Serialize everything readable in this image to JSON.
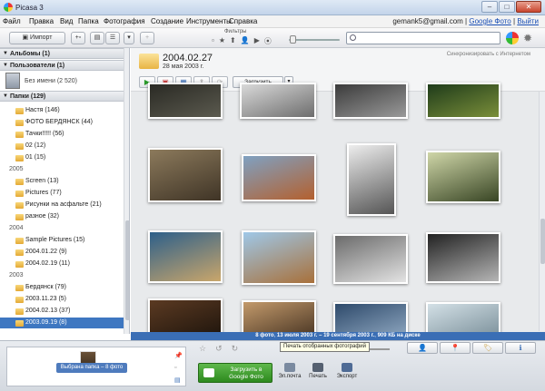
{
  "window": {
    "title": "Picasa 3"
  },
  "menu": {
    "items": [
      "Файл",
      "Правка",
      "Вид",
      "Папка",
      "Фотография",
      "Создание",
      "Инструменты",
      "Справка"
    ],
    "account_email": "gemank5@gmail.com",
    "account_sep": "|",
    "google_photo_link": "Google Фото",
    "exit_link": "Выйти"
  },
  "toolbar": {
    "import_label": "Импорт",
    "filters_label": "Фильтры",
    "search_placeholder": ""
  },
  "left_panel": {
    "albums_header": "Альбомы (1)",
    "users_header": "Пользователи (1)",
    "person_label": "Без имени (2 520)",
    "folders_header": "Папки (129)",
    "groups": [
      {
        "year": "",
        "folders": [
          {
            "name": "Настя (146)"
          },
          {
            "name": "ФОТО БЕРДЯНСК (44)"
          },
          {
            "name": "Тачки!!!!! (56)"
          },
          {
            "name": "02 (12)"
          },
          {
            "name": "01 (15)"
          }
        ]
      },
      {
        "year": "2005",
        "folders": [
          {
            "name": "Screen (13)"
          },
          {
            "name": "Pictures (77)"
          },
          {
            "name": "Рисунки на асфальте (21)"
          },
          {
            "name": "разное (32)"
          }
        ]
      },
      {
        "year": "2004",
        "folders": [
          {
            "name": "Sample Pictures (15)"
          },
          {
            "name": "2004.01.22 (9)"
          },
          {
            "name": "2004.02.19 (11)"
          }
        ]
      },
      {
        "year": "2003",
        "folders": [
          {
            "name": "Бердянск (79)"
          },
          {
            "name": "2003.11.23 (5)"
          },
          {
            "name": "2004.02.13 (37)"
          },
          {
            "name": "2003.09.19 (8)",
            "selected": true
          }
        ]
      }
    ]
  },
  "album": {
    "title": "2004.02.27",
    "date": "28 мая 2003 г.",
    "sync_label": "Синхронизировать с Интернетом",
    "upload_label": "Загрузить"
  },
  "photos": [
    {
      "name": "photo-1",
      "colors": [
        "#2a2a24",
        "#5b5a4f"
      ]
    },
    {
      "name": "photo-2",
      "colors": [
        "#d9d9d9",
        "#6d6d6d"
      ]
    },
    {
      "name": "photo-3",
      "colors": [
        "#3b3b3b",
        "#9a9a9a"
      ]
    },
    {
      "name": "photo-4",
      "colors": [
        "#1e3b1a",
        "#7b8f3a"
      ]
    },
    {
      "name": "photo-5",
      "colors": [
        "#8c7a5c",
        "#3f3426"
      ]
    },
    {
      "name": "photo-6",
      "colors": [
        "#7fa1c2",
        "#b4602e"
      ]
    },
    {
      "name": "photo-7",
      "colors": [
        "#ededed",
        "#555555"
      ]
    },
    {
      "name": "photo-8",
      "colors": [
        "#cfd6a8",
        "#384524"
      ]
    },
    {
      "name": "photo-9",
      "colors": [
        "#2d5f8a",
        "#c9a66b"
      ]
    },
    {
      "name": "photo-10",
      "colors": [
        "#9fc8e8",
        "#a8703a"
      ]
    },
    {
      "name": "photo-11",
      "colors": [
        "#6b6b6b",
        "#e3e3e3"
      ]
    },
    {
      "name": "photo-12",
      "colors": [
        "#222222",
        "#b5b5b5"
      ]
    },
    {
      "name": "photo-13",
      "colors": [
        "#5b3a22",
        "#1a120b"
      ]
    },
    {
      "name": "photo-14",
      "colors": [
        "#c39a6b",
        "#3b2a1c"
      ]
    },
    {
      "name": "photo-15",
      "colors": [
        "#2e4a6b",
        "#9cb4cc"
      ]
    },
    {
      "name": "photo-16",
      "colors": [
        "#d3e0e6",
        "#6f8590"
      ]
    },
    {
      "name": "photo-17",
      "colors": [
        "#2f5a2a",
        "#8fb5d6"
      ]
    }
  ],
  "status": {
    "count": "8 фото",
    "range": "13 июля 2003 г. – 19 сентября 2003 г.",
    "size": "909 КБ на диске"
  },
  "tray": {
    "selection_label": "Выбрана папка – 8 фото",
    "tooltip": "Печать отобранных фотографий",
    "upload_button": "Загрузить в Google Фото",
    "actions": [
      {
        "label": "Эл.почта",
        "color": "#7a8aa0"
      },
      {
        "label": "Печать",
        "color": "#556070"
      },
      {
        "label": "Экспорт",
        "color": "#4f6b95"
      }
    ]
  },
  "colors": {
    "selection": "#3e77c1",
    "status_bar": "#3a6eb5",
    "upload_green": "#2d8a1e"
  }
}
